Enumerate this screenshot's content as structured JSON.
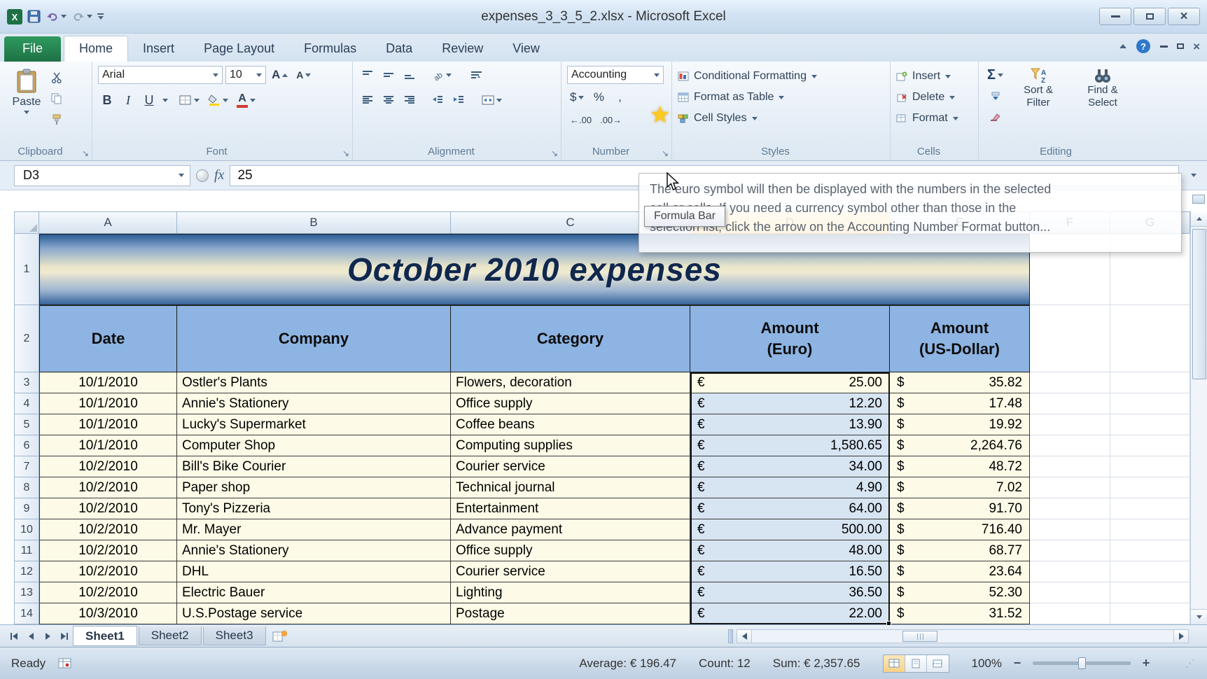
{
  "window": {
    "title": "expenses_3_3_5_2.xlsx  -  Microsoft Excel"
  },
  "ribbon": {
    "tabs": [
      {
        "label": "File"
      },
      {
        "label": "Home"
      },
      {
        "label": "Insert"
      },
      {
        "label": "Page Layout"
      },
      {
        "label": "Formulas"
      },
      {
        "label": "Data"
      },
      {
        "label": "Review"
      },
      {
        "label": "View"
      }
    ],
    "clipboard": {
      "paste": "Paste",
      "label": "Clipboard"
    },
    "font": {
      "family": "Arial",
      "size": "10",
      "bold": "B",
      "italic": "I",
      "underline": "U",
      "label": "Font"
    },
    "alignment": {
      "label": "Alignment"
    },
    "number": {
      "format": "Accounting",
      "currency": "$",
      "percent": "%",
      "comma": ",",
      "inc_decimal": "←.00",
      "dec_decimal": ".00→",
      "label": "Number"
    },
    "styles": {
      "conditional": "Conditional Formatting",
      "format_table": "Format as Table",
      "cell_styles": "Cell Styles",
      "label": "Styles"
    },
    "cells": {
      "insert": "Insert",
      "delete": "Delete",
      "format": "Format",
      "label": "Cells"
    },
    "editing": {
      "sigma": "Σ",
      "sort1": "Sort &",
      "sort2": "Filter",
      "find1": "Find &",
      "find2": "Select",
      "label": "Editing"
    }
  },
  "tooltip": {
    "line1": "The euro symbol will then be displayed with the numbers in the selected",
    "line2": "cell or cells. If you need a currency symbol other than those in the",
    "line3": "selection list, click the arrow on the Accounting Number Format button...",
    "star": "★"
  },
  "formula_bar": {
    "cell_ref": "D3",
    "fx": "fx",
    "value": "25",
    "tooltip": "Formula Bar"
  },
  "grid": {
    "columns": [
      "A",
      "B",
      "C",
      "D",
      "E",
      "F",
      "G"
    ],
    "title": "October 2010 expenses",
    "title_row": {
      "num": "1"
    },
    "header_row": {
      "num": "2",
      "date": "Date",
      "company": "Company",
      "category": "Category",
      "amount_euro_1": "Amount",
      "amount_euro_2": "(Euro)",
      "amount_usd_1": "Amount",
      "amount_usd_2": "(US-Dollar)"
    },
    "currency": {
      "eur": "€",
      "usd": "$"
    },
    "rows": [
      {
        "num": "3",
        "date": "10/1/2010",
        "company": "Ostler's Plants",
        "category": "Flowers, decoration",
        "eur": "25.00",
        "usd": "35.82"
      },
      {
        "num": "4",
        "date": "10/1/2010",
        "company": "Annie's Stationery",
        "category": "Office supply",
        "eur": "12.20",
        "usd": "17.48"
      },
      {
        "num": "5",
        "date": "10/1/2010",
        "company": "Lucky's Supermarket",
        "category": "Coffee beans",
        "eur": "13.90",
        "usd": "19.92"
      },
      {
        "num": "6",
        "date": "10/1/2010",
        "company": "Computer Shop",
        "category": "Computing supplies",
        "eur": "1,580.65",
        "usd": "2,264.76"
      },
      {
        "num": "7",
        "date": "10/2/2010",
        "company": "Bill's Bike Courier",
        "category": "Courier service",
        "eur": "34.00",
        "usd": "48.72"
      },
      {
        "num": "8",
        "date": "10/2/2010",
        "company": "Paper shop",
        "category": "Technical journal",
        "eur": "4.90",
        "usd": "7.02"
      },
      {
        "num": "9",
        "date": "10/2/2010",
        "company": "Tony's Pizzeria",
        "category": "Entertainment",
        "eur": "64.00",
        "usd": "91.70"
      },
      {
        "num": "10",
        "date": "10/2/2010",
        "company": "Mr. Mayer",
        "category": "Advance payment",
        "eur": "500.00",
        "usd": "716.40"
      },
      {
        "num": "11",
        "date": "10/2/2010",
        "company": "Annie's Stationery",
        "category": "Office supply",
        "eur": "48.00",
        "usd": "68.77"
      },
      {
        "num": "12",
        "date": "10/2/2010",
        "company": "DHL",
        "category": "Courier service",
        "eur": "16.50",
        "usd": "23.64"
      },
      {
        "num": "13",
        "date": "10/2/2010",
        "company": "Electric Bauer",
        "category": "Lighting",
        "eur": "36.50",
        "usd": "52.30"
      },
      {
        "num": "14",
        "date": "10/3/2010",
        "company": "U.S.Postage service",
        "category": "Postage",
        "eur": "22.00",
        "usd": "31.52"
      }
    ]
  },
  "sheet_tabs": {
    "tabs": [
      {
        "label": "Sheet1",
        "active": true
      },
      {
        "label": "Sheet2",
        "active": false
      },
      {
        "label": "Sheet3",
        "active": false
      }
    ]
  },
  "status_bar": {
    "mode": "Ready",
    "average": "Average:  € 196.47",
    "count": "Count: 12",
    "sum": "Sum:  € 2,357.65",
    "zoom": "100%"
  },
  "colors": {
    "file_tab_green": "#1e7145",
    "selected_column_header": "#fbd888",
    "selection_fill": "#d7e4f2",
    "table_header_blue": "#8db4e2",
    "data_row_cream": "#fdfbe7"
  }
}
